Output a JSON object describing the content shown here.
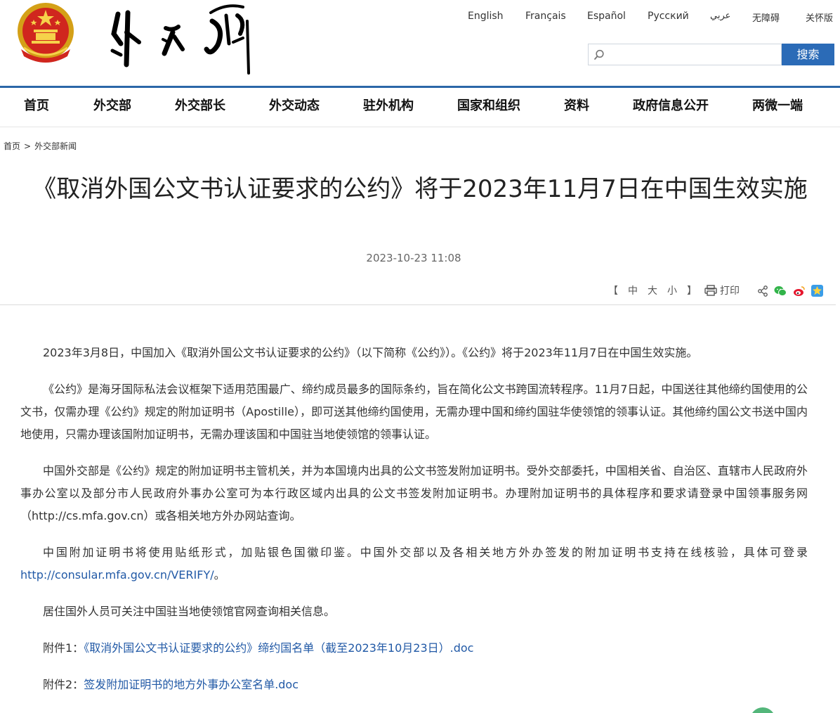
{
  "header": {
    "languages": [
      "English",
      "Français",
      "Español",
      "Русский",
      "عربي",
      "无障碍",
      "关怀版"
    ],
    "search": {
      "placeholder": "",
      "button_label": "搜索"
    },
    "logo_text": "外交部"
  },
  "nav": [
    "首页",
    "外交部",
    "外交部长",
    "外交动态",
    "驻外机构",
    "国家和组织",
    "资料",
    "政府信息公开",
    "两微一端"
  ],
  "breadcrumb": {
    "home": "首页",
    "separator": ">",
    "current": "外交部新闻"
  },
  "article": {
    "title": "《取消外国公文书认证要求的公约》将于2023年11月7日在中国生效实施",
    "date": "2023-10-23 11:08",
    "paragraphs": [
      "2023年3月8日，中国加入《取消外国公文书认证要求的公约》（以下简称《公约》）。《公约》将于2023年11月7日在中国生效实施。",
      "《公约》是海牙国际私法会议框架下适用范围最广、缔约成员最多的国际条约，旨在简化公文书跨国流转程序。11月7日起，中国送往其他缔约国使用的公文书，仅需办理《公约》规定的附加证明书（Apostille），即可送其他缔约国使用，无需办理中国和缔约国驻华使领馆的领事认证。其他缔约国公文书送中国内地使用，只需办理该国附加证明书，无需办理该国和中国驻当地使领馆的领事认证。",
      "中国外交部是《公约》规定的附加证明书主管机关，并为本国境内出具的公文书签发附加证明书。受外交部委托，中国相关省、自治区、直辖市人民政府外事办公室以及部分市人民政府外事办公室可为本行政区域内出具的公文书签发附加证明书。办理附加证明书的具体程序和要求请登录中国领事服务网（http://cs.mfa.gov.cn）或各相关地方外办网站查询。"
    ],
    "para4_text": "中国附加证明书将使用贴纸形式，加贴银色国徽印鉴。中国外交部以及各相关地方外办签发的附加证明书支持在线核验，具体可登录",
    "para4_link": "http://consular.mfa.gov.cn/VERIFY/",
    "para4_end": "。",
    "para5": "居住国外人员可关注中国驻当地使领馆官网查询相关信息。",
    "attachments": [
      {
        "label": "附件1：",
        "link": "《取消外国公文书认证要求的公约》缔约国名单（截至2023年10月23日）.doc"
      },
      {
        "label": "附件2：",
        "link": "签发附加证明书的地方外事办公室名单.doc"
      }
    ]
  },
  "tools": {
    "bracket_open": "【",
    "sizes": [
      "中",
      "大",
      "小"
    ],
    "bracket_close": "】",
    "print_label": "打印"
  },
  "colors": {
    "brand_blue": "#2b67a8",
    "link": "#2159a6",
    "search_button": "#2b6bb7"
  }
}
